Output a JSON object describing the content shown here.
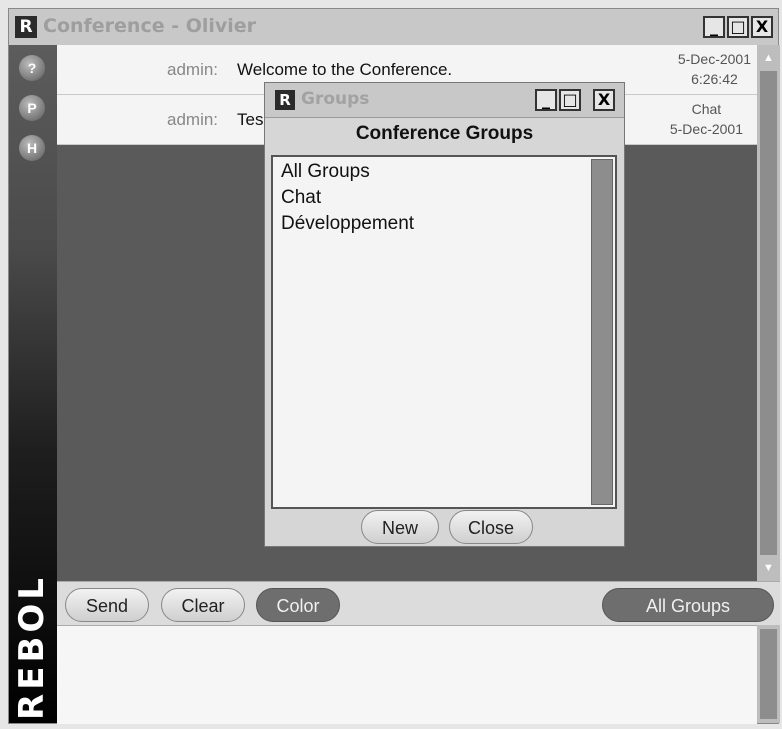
{
  "window": {
    "logo": "R",
    "title": "Conference - Olivier",
    "minimize": "_",
    "maximize": "□",
    "close": "X"
  },
  "sidebar": {
    "buttons": [
      "?",
      "P",
      "H"
    ],
    "brand": "REBOL"
  },
  "messages": [
    {
      "user": "admin:",
      "text": "Welcome to the Conference.",
      "date": "5-Dec-2001",
      "time": "6:26:42"
    },
    {
      "user": "admin:",
      "text": "Tes",
      "group": "Chat",
      "date": "5-Dec-2001"
    }
  ],
  "toolbar": {
    "send": "Send",
    "clear": "Clear",
    "color": "Color",
    "groups": "All Groups"
  },
  "groups_dialog": {
    "logo": "R",
    "title": "Groups",
    "minimize": "_",
    "maximize": "□",
    "close": "X",
    "heading": "Conference Groups",
    "items": [
      "All Groups",
      "Chat",
      "Développement"
    ],
    "new_label": "New",
    "close_label": "Close"
  },
  "colors": {
    "dark_area": "#5a5a5a",
    "title_text": "#9e9e9e"
  }
}
